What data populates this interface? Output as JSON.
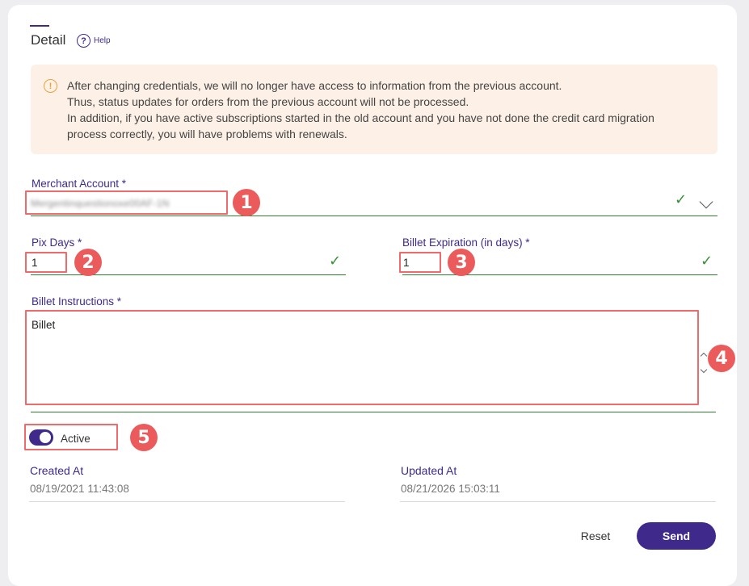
{
  "header": {
    "title": "Detail",
    "help_label": "Help"
  },
  "alert": {
    "lines": [
      "After changing credentials, we will no longer have access to information from the previous account.",
      "Thus, status updates for orders from the previous account will not be processed.",
      "In addition, if you have active subscriptions started in the old account and you have not done the credit card migration",
      "process correctly, you will have problems with renewals."
    ]
  },
  "form": {
    "merchant_account": {
      "label": "Merchant Account *",
      "value": "Mergentinquestionoxe00AF-1N"
    },
    "pix_days": {
      "label": "Pix Days *",
      "value": "1"
    },
    "billet_expiration": {
      "label": "Billet Expiration (in days) *",
      "value": "1"
    },
    "billet_instructions": {
      "label": "Billet Instructions *",
      "value": "Billet"
    },
    "active": {
      "label": "Active",
      "checked": true
    }
  },
  "meta": {
    "created_label": "Created At",
    "created_value": "08/19/2021 11:43:08",
    "updated_label": "Updated At",
    "updated_value": "08/21/2026 15:03:11"
  },
  "actions": {
    "reset_label": "Reset",
    "send_label": "Send"
  },
  "annotations": [
    "1",
    "2",
    "3",
    "4",
    "5"
  ],
  "colors": {
    "brand": "#3f2a8c",
    "alert_bg": "#fdf0e6",
    "alert_icon": "#e8a33b",
    "valid": "#2e7d32",
    "highlight": "#ef6b6b"
  }
}
